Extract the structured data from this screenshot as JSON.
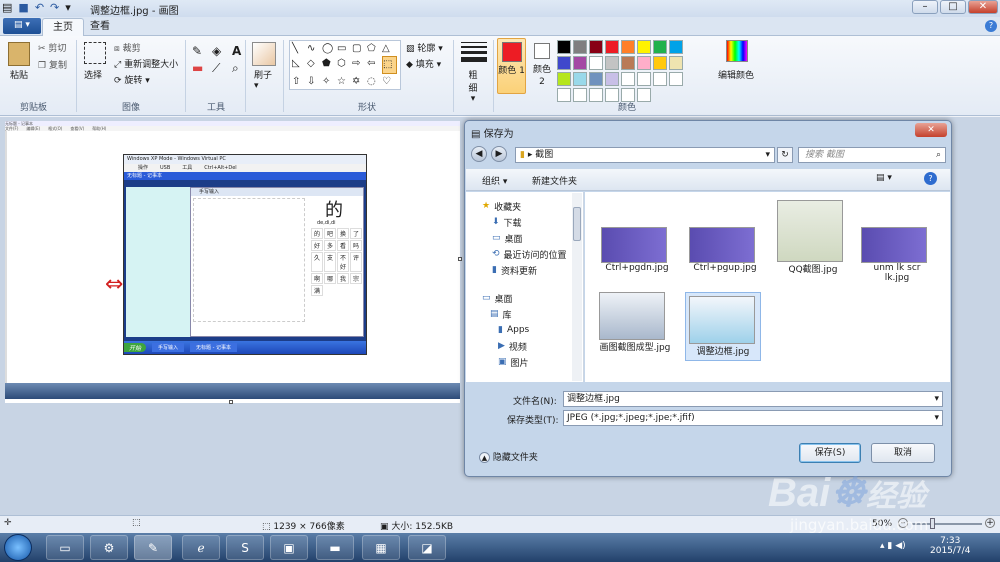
{
  "window": {
    "title": "调整边框.jpg - 画图"
  },
  "ribbon": {
    "tabs": [
      "主页",
      "查看"
    ],
    "clipboard": {
      "paste": "粘贴",
      "cut": "剪切",
      "copy": "复制",
      "label": "剪贴板"
    },
    "image": {
      "select": "选择",
      "crop": "裁剪",
      "resize": "重新调整大小",
      "rotate": "旋转",
      "label": "图像"
    },
    "tools": {
      "label": "工具"
    },
    "brush": {
      "label": "刷子"
    },
    "shapes": {
      "outline": "轮廓",
      "fill": "填充",
      "label": "形状"
    },
    "size": {
      "label": "粗细"
    },
    "colors": {
      "color1": "颜色 1",
      "color2": "颜色 2",
      "edit": "编辑颜色",
      "label": "颜色",
      "palette": [
        "#000000",
        "#7f7f7f",
        "#880015",
        "#ed1c24",
        "#ff7f27",
        "#fff200",
        "#22b14c",
        "#00a2e8",
        "#3f48cc",
        "#a349a4",
        "#ffffff",
        "#c3c3c3",
        "#b97a57",
        "#ffaec9",
        "#ffc90e",
        "#efe4b0",
        "#b5e61d",
        "#99d9ea",
        "#7092be",
        "#c8bfe7",
        "#ffffff",
        "#ffffff",
        "#ffffff",
        "#ffffff",
        "#ffffff",
        "#ffffff",
        "#ffffff",
        "#ffffff",
        "#ffffff",
        "#ffffff"
      ]
    }
  },
  "canvas_content": {
    "notepad_title": "无标题 - 记事本",
    "notepad_menu": [
      "文件(F)",
      "编辑(E)",
      "格式(O)",
      "查看(V)",
      "帮助(H)"
    ],
    "vm_title": "Windows XP Mode - Windows Virtual PC",
    "vm_menu": [
      "操作",
      "USB",
      "工具",
      "Ctrl+Alt+Del"
    ],
    "handwriting_title": "手写输入",
    "char": "的",
    "pinyin": "de,di,di",
    "candidates": [
      "的",
      "吧",
      "换",
      "了",
      "好",
      "多",
      "看",
      "吗",
      "久",
      "支",
      "不好",
      "评",
      "啊",
      "哪",
      "我",
      "宗",
      "满"
    ],
    "start": "开始",
    "task1": "手写输入",
    "task2": "无标题 - 记事本"
  },
  "dialog": {
    "title": "保存为",
    "breadcrumb": "截图",
    "search_placeholder": "搜索 截图",
    "toolbar": {
      "organize": "组织",
      "new_folder": "新建文件夹"
    },
    "nav": [
      "收藏夹",
      "下载",
      "桌面",
      "最近访问的位置",
      "资料更新",
      "桌面",
      "库",
      "Apps",
      "视频",
      "图片"
    ],
    "files": [
      "Ctrl+pgdn.jpg",
      "Ctrl+pgup.jpg",
      "QQ截图.jpg",
      "unm lk scr lk.jpg",
      "画图截图成型.jpg",
      "调整边框.jpg"
    ],
    "filename_label": "文件名(N):",
    "filename_value": "调整边框.jpg",
    "filetype_label": "保存类型(T):",
    "filetype_value": "JPEG (*.jpg;*.jpeg;*.jpe;*.jfif)",
    "hide_folders": "隐藏文件夹",
    "save": "保存(S)",
    "cancel": "取消"
  },
  "status": {
    "dimensions": "1239 × 766像素",
    "size": "大小: 152.5KB",
    "zoom": "50%"
  },
  "taskbar": {
    "time": "7:33",
    "date": "2015/7/4"
  },
  "watermark": {
    "brand": "Bai",
    "brand2": "经验",
    "url": "jingyan.baidu.com"
  }
}
